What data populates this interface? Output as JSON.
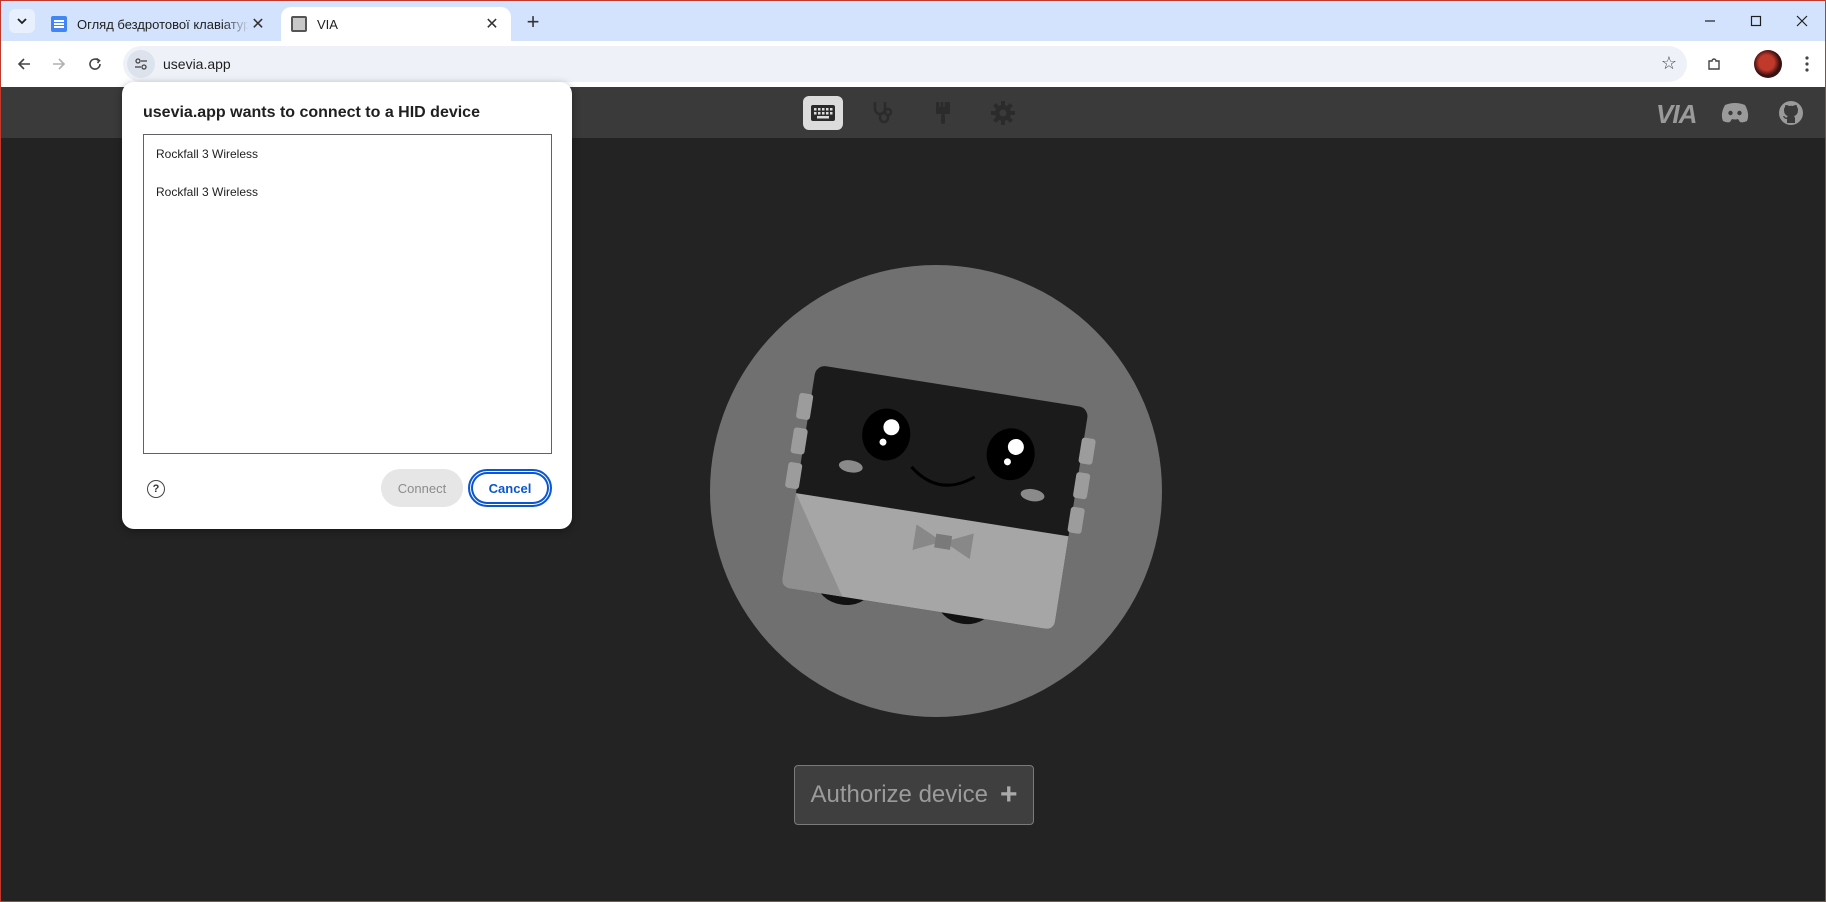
{
  "browser": {
    "tabs": [
      {
        "title": "Огляд бездротової клавіатури",
        "icon": "google-docs-icon",
        "active": false
      },
      {
        "title": "VIA",
        "icon": "via-icon",
        "active": true
      }
    ],
    "address": "usevia.app"
  },
  "dialog": {
    "title": "usevia.app wants to connect to a HID device",
    "devices": [
      "Rockfall 3 Wireless",
      "Rockfall 3 Wireless"
    ],
    "connect_label": "Connect",
    "cancel_label": "Cancel",
    "help_icon": "?"
  },
  "page": {
    "nav_icons": [
      "keyboard-icon",
      "stethoscope-icon",
      "paintbrush-icon",
      "gear-icon"
    ],
    "brand": "VIA",
    "authorize_label": "Authorize device",
    "authorize_icon": "+"
  },
  "colors": {
    "tabstrip": "#d3e3fd",
    "page_bg": "#232323",
    "nav_bg": "#3a3a3a",
    "accent": "#0b57d0"
  }
}
